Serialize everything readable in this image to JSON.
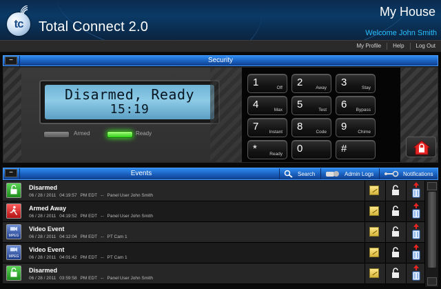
{
  "header": {
    "logo_text": "tc",
    "app_title": "Total Connect 2.0",
    "location": "My House",
    "welcome": "Welcome John Smith"
  },
  "nav": {
    "links": [
      "My Profile",
      "Help",
      "Log Out"
    ]
  },
  "security": {
    "title": "Security",
    "collapse_label": "−",
    "lcd_line1": "Disarmed, Ready",
    "lcd_line2": "15:19",
    "indicators": {
      "armed": "Armed",
      "ready": "Ready"
    },
    "keys": [
      {
        "num": "1",
        "sub": "Off"
      },
      {
        "num": "2",
        "sub": "Away"
      },
      {
        "num": "3",
        "sub": "Stay"
      },
      {
        "num": "4",
        "sub": "Max"
      },
      {
        "num": "5",
        "sub": "Test"
      },
      {
        "num": "6",
        "sub": "Bypass"
      },
      {
        "num": "7",
        "sub": "Instant"
      },
      {
        "num": "8",
        "sub": "Code"
      },
      {
        "num": "9",
        "sub": "Chime"
      },
      {
        "num": "*",
        "sub": "Ready"
      },
      {
        "num": "0",
        "sub": ""
      },
      {
        "num": "#",
        "sub": ""
      }
    ]
  },
  "events": {
    "title": "Events",
    "collapse_label": "−",
    "tools": {
      "search": "Search",
      "admin_logs": "Admin Logs",
      "notifications": "Notifications"
    },
    "rows": [
      {
        "type": "disarmed",
        "title": "Disarmed",
        "date": "06 / 28 / 2011",
        "time": "04:19:57",
        "tz": "PM EDT",
        "sep": "--",
        "source": "Panel User John Smith",
        "tag": ""
      },
      {
        "type": "armed",
        "title": "Armed Away",
        "date": "06 / 28 / 2011",
        "time": "04:19:52",
        "tz": "PM EDT",
        "sep": "--",
        "source": "Panel User John Smith",
        "tag": ""
      },
      {
        "type": "video",
        "title": "Video Event",
        "date": "06 / 28 / 2011",
        "time": "04:12:04",
        "tz": "PM EDT",
        "sep": "--",
        "source": "PT Cam 1",
        "tag": "MPEG"
      },
      {
        "type": "video",
        "title": "Video Event",
        "date": "06 / 28 / 2011",
        "time": "04:01:42",
        "tz": "PM EDT",
        "sep": "--",
        "source": "PT Cam 1",
        "tag": "MPEG"
      },
      {
        "type": "disarmed",
        "title": "Disarmed",
        "date": "06 / 28 / 2011",
        "time": "03:59:58",
        "tz": "PM EDT",
        "sep": "--",
        "source": "Panel User John Smith",
        "tag": ""
      }
    ]
  },
  "colors": {
    "accent_blue": "#1a5fbd",
    "welcome_cyan": "#27c0ff",
    "ready_green": "#2ed01a",
    "armed_red": "#b41414",
    "lcd_blue": "#8dcbe7"
  }
}
